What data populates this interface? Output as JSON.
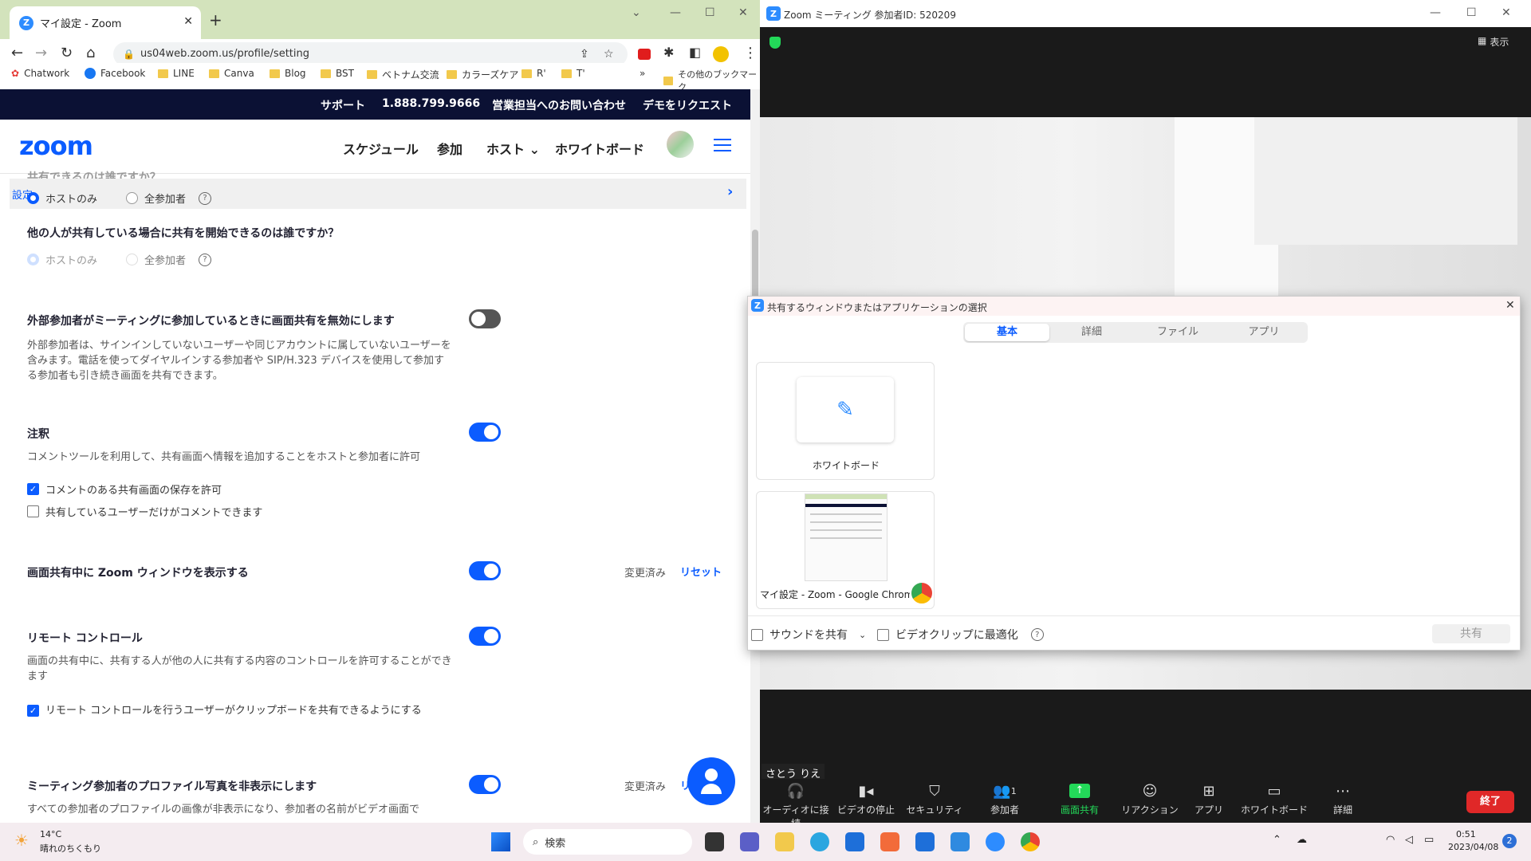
{
  "chrome": {
    "tab_title": "マイ設定 - Zoom",
    "url": "us04web.zoom.us/profile/setting",
    "bookmarks": [
      "Chatwork",
      "Facebook",
      "LINE",
      "Canva",
      "Blog",
      "BST",
      "ベトナム交流",
      "カラーズケア",
      "R'",
      "T'"
    ],
    "bookmarks_more": "»",
    "other_bookmarks": "その他のブックマーク"
  },
  "zoom_site": {
    "topbar": {
      "support": "サポート",
      "phone": "1.888.799.9666",
      "sales": "営業担当へのお問い合わせ",
      "demo": "デモをリクエスト"
    },
    "logo": "zoom",
    "nav": [
      "スケジュール",
      "参加",
      "ホスト",
      "ホワイトボード"
    ],
    "ghost_text": "共有できるのは誰ですか？",
    "settings_tab": "設定",
    "q1": {
      "host": "ホストのみ",
      "all": "全参加者",
      "help": "?"
    },
    "q2": {
      "title": "他の人が共有している場合に共有を開始できるのは誰ですか？",
      "host": "ホストのみ",
      "all": "全参加者",
      "help": "?"
    },
    "external": {
      "title": "外部参加者がミーティングに参加しているときに画面共有を無効にします",
      "desc": "外部参加者は、サインインしていないユーザーや同じアカウントに属していないユーザーを含みます。電話を使ってダイヤルインする参加者や SIP/H.323 デバイスを使用して参加する参加者も引き続き画面を共有できます。",
      "enabled": false
    },
    "annotation": {
      "title": "注釈",
      "desc": "コメントツールを利用して、共有画面へ情報を追加することをホストと参加者に許可",
      "cb1": "コメントのある共有画面の保存を許可",
      "cb2": "共有しているユーザーだけがコメントできます",
      "enabled": true
    },
    "show_window": {
      "title": "画面共有中に Zoom ウィンドウを表示する",
      "changed": "変更済み",
      "reset": "リセット",
      "enabled": true
    },
    "remote": {
      "title": "リモート コントロール",
      "desc": "画面の共有中に、共有する人が他の人に共有する内容のコントロールを許可することができます",
      "cb": "リモート コントロールを行うユーザーがクリップボードを共有できるようにする",
      "enabled": true
    },
    "hide_photo": {
      "title": "ミーティング参加者のプロファイル写真を非表示にします",
      "desc": "すべての参加者のプロファイルの画像が非表示になり、参加者の名前がビデオ画面で",
      "changed": "変更済み",
      "reset": "リ",
      "enabled": true
    }
  },
  "meeting": {
    "title": "Zoom ミーティング 参加者ID: 520209",
    "view_label": "表示",
    "participant_name": "さとう りえ",
    "participants_count": "1",
    "toolbar": [
      "オーディオに接続",
      "ビデオの停止",
      "セキュリティ",
      "参加者",
      "画面共有",
      "リアクション",
      "アプリ",
      "ホワイトボード",
      "詳細"
    ],
    "end": "終了",
    "share_green": "#23d959"
  },
  "share_dialog": {
    "title": "共有するウィンドウまたはアプリケーションの選択",
    "tabs": [
      "基本",
      "詳細",
      "ファイル",
      "アプリ"
    ],
    "active_tab": "基本",
    "items": [
      "ホワイトボード",
      "マイ設定 - Zoom - Google Chrome"
    ],
    "sound": "サウンドを共有",
    "optimize": "ビデオクリップに最適化",
    "share_button": "共有"
  },
  "taskbar": {
    "temp": "14°C",
    "weather": "晴れのちくもり",
    "search": "検索",
    "time": "0:51",
    "date": "2023/04/08",
    "notif": "2"
  },
  "colors": {
    "zoom_blue": "#0b5cff",
    "topbar": "#0b1134",
    "tab_green": "#d3e3bc"
  }
}
